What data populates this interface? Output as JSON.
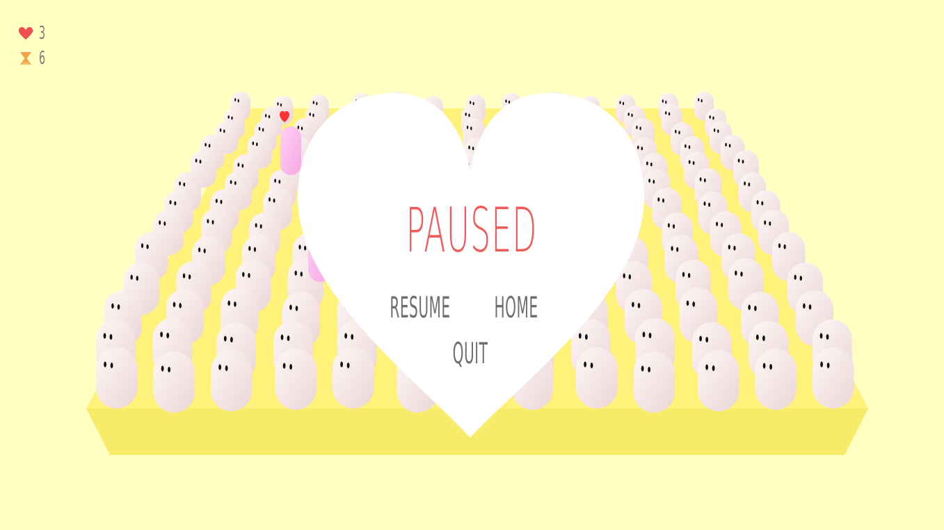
{
  "hud": {
    "lives": "3",
    "timer": "6",
    "lives_icon": "heart-icon",
    "timer_icon": "hourglass-icon"
  },
  "pause_menu": {
    "title": "PAUSED",
    "resume_label": "RESUME",
    "home_label": "HOME",
    "quit_label": "QUIT"
  },
  "colors": {
    "background": "#ffffc2",
    "platform_top": "#fff27a",
    "platform_front": "#f7ec6a",
    "ghost": "#f8eded",
    "player": "#ffb8ee",
    "heart_panel": "#ffffff",
    "title": "#f25a5a",
    "menu_text": "#6f6f6f",
    "hud_heart": "#f04f4f",
    "hud_hourglass": "#f5a24a"
  }
}
